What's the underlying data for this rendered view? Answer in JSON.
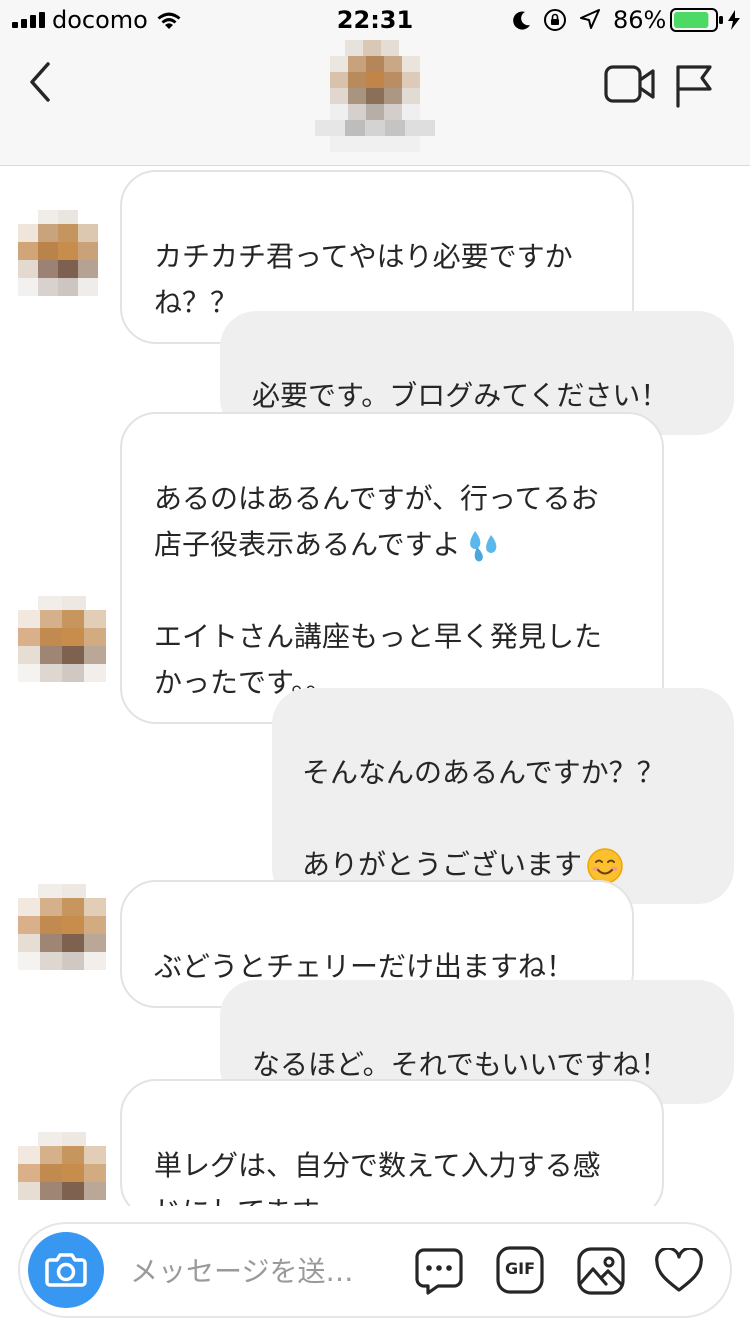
{
  "status_bar": {
    "carrier": "docomo",
    "time": "22:31",
    "battery_percent": "86%",
    "battery_level": 0.86,
    "battery_color": "#4cd964"
  },
  "header": {
    "back_icon": "chevron-left-icon",
    "video_icon": "video-camera-icon",
    "flag_icon": "flag-icon"
  },
  "messages": [
    {
      "side": "in",
      "text": "カチカチ君ってやはり必要ですか\nね？？"
    },
    {
      "side": "out",
      "text": "必要です。ブログみてください！"
    },
    {
      "side": "in",
      "text": "あるのはあるんですが、行ってるお\n店子役表示あるんですよ",
      "emoji": "sweat-droplets-emoji",
      "text2": "\n\nエイトさん講座もっと早く発見した\nかったです。。"
    },
    {
      "side": "out",
      "text": "そんなんのあるんですか？？\n\nありがとうございます",
      "emoji": "smiling-face-emoji"
    },
    {
      "side": "in",
      "text": "ぶどうとチェリーだけ出ますね！"
    },
    {
      "side": "out",
      "text": "なるほど。それでもいいですね！"
    },
    {
      "side": "in",
      "text": "単レグは、自分で数えて入力する感\nじにしてますー"
    }
  ],
  "composer": {
    "placeholder": "メッセージを送…",
    "gif_label": "GIF",
    "accent": "#3897f0",
    "icons": [
      "camera-icon",
      "chat-bubble-icon",
      "gif-icon",
      "gallery-icon",
      "heart-icon"
    ]
  }
}
